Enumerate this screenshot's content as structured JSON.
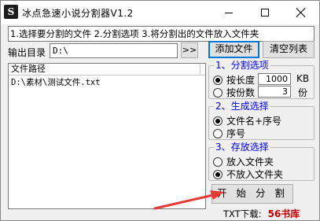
{
  "window": {
    "title": "冰点急速小说分割器V1.2",
    "app_icon_glyph": "S"
  },
  "instructions": "1.选择要分割的文件 2.分割选项 3.将分割出的文件放入文件夹",
  "output": {
    "label": "输出目录",
    "value": "D:\\",
    "browse_label": ">>"
  },
  "toolbar": {
    "add_file_label": "添加文件",
    "clear_list_label": "清空列表"
  },
  "file_list": {
    "column_header": "文件路径",
    "rows": [
      "D:\\素材\\测试文件.txt"
    ]
  },
  "split_options": {
    "title": "1、分割选项",
    "by_length_label": "按长度",
    "by_length_value": "1000",
    "by_length_unit": "KB",
    "by_length_checked": true,
    "by_parts_label": "按份数",
    "by_parts_value": "3",
    "by_parts_unit": "份",
    "by_parts_checked": false
  },
  "naming_options": {
    "title": "2、生成选择",
    "filename_seq_label": "文件名+序号",
    "filename_seq_checked": true,
    "seq_only_label": "序号",
    "seq_only_checked": false
  },
  "storage_options": {
    "title": "3、存放选择",
    "into_folder_label": "放入文件夹",
    "into_folder_checked": false,
    "no_folder_label": "不放入文件夹",
    "no_folder_checked": true
  },
  "start_button_label": "开 始 分 割",
  "footer": {
    "download_text": "TXT下载:",
    "site_text": "56书库"
  },
  "colors": {
    "group_title": "#0000ff",
    "footer_site": "#c00000",
    "annotation_arrow": "#e53935"
  }
}
